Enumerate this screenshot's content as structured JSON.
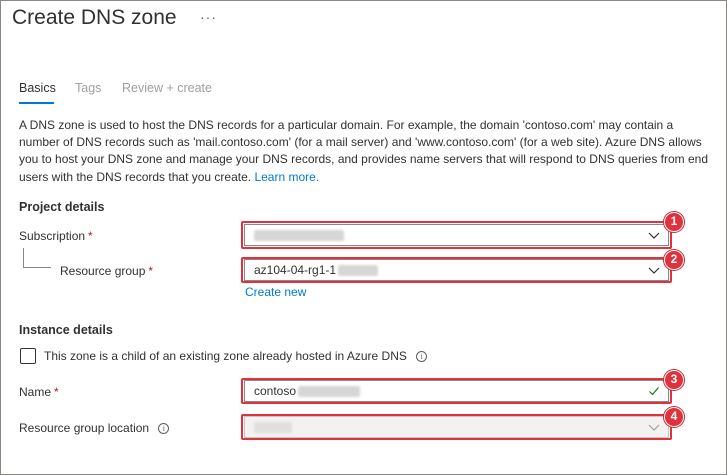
{
  "page": {
    "title": "Create DNS zone",
    "more_icon": "ellipsis-icon",
    "more_glyph": "···"
  },
  "tabs": [
    {
      "label": "Basics",
      "state": "active"
    },
    {
      "label": "Tags",
      "state": "disabled"
    },
    {
      "label": "Review + create",
      "state": "disabled"
    }
  ],
  "description": {
    "text": "A DNS zone is used to host the DNS records for a particular domain. For example, the domain 'contoso.com' may contain a number of DNS records such as 'mail.contoso.com' (for a mail server) and 'www.contoso.com' (for a web site). Azure DNS allows you to host your DNS zone and manage your DNS records, and provides name servers that will respond to DNS queries from end users with the DNS records that you create.",
    "learn_more": "Learn more."
  },
  "project_details": {
    "heading": "Project details",
    "subscription_label": "Subscription",
    "resource_group_label": "Resource group",
    "resource_group_value": "az104-04-rg1-1",
    "create_new": "Create new",
    "required_mark": "*"
  },
  "instance_details": {
    "heading": "Instance details",
    "child_zone_label": "This zone is a child of an existing zone already hosted in Azure DNS",
    "name_label": "Name",
    "name_value": "contoso",
    "location_label": "Resource group location"
  },
  "callouts": [
    "1",
    "2",
    "3",
    "4"
  ],
  "colors": {
    "accent": "#0078d4",
    "callout": "#e0313c",
    "required": "#a4262c",
    "valid": "#107c10"
  }
}
